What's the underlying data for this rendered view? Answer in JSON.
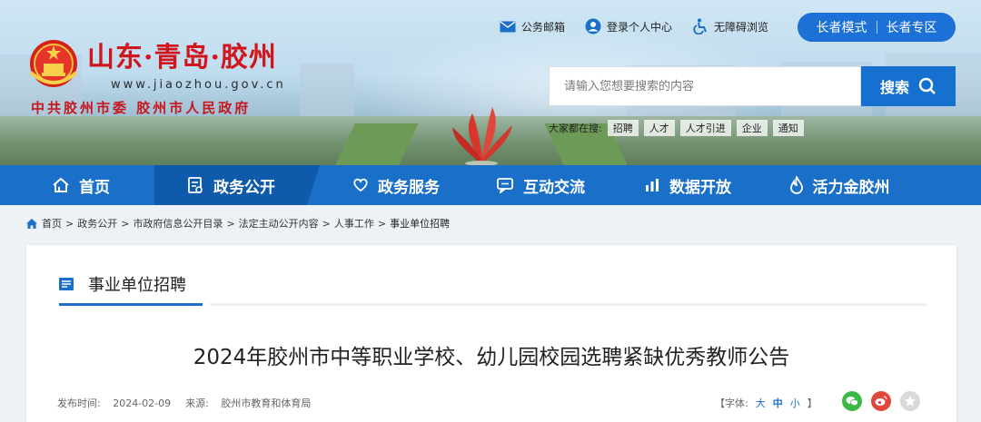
{
  "header": {
    "site_title": "山东·青岛·胶州",
    "site_url": "www.jiaozhou.gov.cn",
    "site_org": "中共胶州市委  胶州市人民政府",
    "top_links": [
      "公务邮箱",
      "登录个人中心",
      "无障碍浏览"
    ],
    "elder_mode": "长者模式",
    "elder_zone": "长者专区",
    "search": {
      "placeholder": "请输入您想要搜索的内容",
      "button": "搜索"
    },
    "hot": {
      "label": "大家都在搜:",
      "tags": [
        "招聘",
        "人才",
        "人才引进",
        "企业",
        "通知"
      ]
    }
  },
  "nav": {
    "items": [
      "首页",
      "政务公开",
      "政务服务",
      "互动交流",
      "数据开放",
      "活力金胶州"
    ],
    "active_index": 1
  },
  "breadcrumb": [
    "首页",
    "政务公开",
    "市政府信息公开目录",
    "法定主动公开内容",
    "人事工作",
    "事业单位招聘"
  ],
  "section": {
    "title": "事业单位招聘"
  },
  "article": {
    "title": "2024年胶州市中等职业学校、幼儿园校园选聘紧缺优秀教师公告",
    "publish_label": "发布时间:",
    "publish_date": "2024-02-09",
    "source_label": "来源:",
    "source": "胶州市教育和体育局",
    "font_label": "【字体:",
    "font_sizes": [
      "大",
      "中",
      "小"
    ],
    "font_end": "】"
  },
  "colors": {
    "brand_blue": "#1a6fc9",
    "title_red": "#d0161c"
  }
}
